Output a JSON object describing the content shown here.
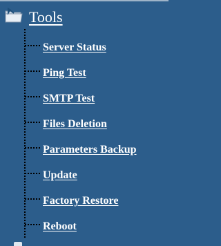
{
  "tree": {
    "root_label": "Tools",
    "items": [
      {
        "label": "Server Status"
      },
      {
        "label": "Ping Test"
      },
      {
        "label": "SMTP Test"
      },
      {
        "label": "Files Deletion"
      },
      {
        "label": "Parameters Backup"
      },
      {
        "label": "Update"
      },
      {
        "label": "Factory Restore"
      },
      {
        "label": "Reboot"
      }
    ]
  },
  "colors": {
    "background": "#2c5d8b",
    "text": "#ffffff",
    "tree_line": "#000000"
  },
  "icons": {
    "root": "folder-with-arrow-icon"
  }
}
